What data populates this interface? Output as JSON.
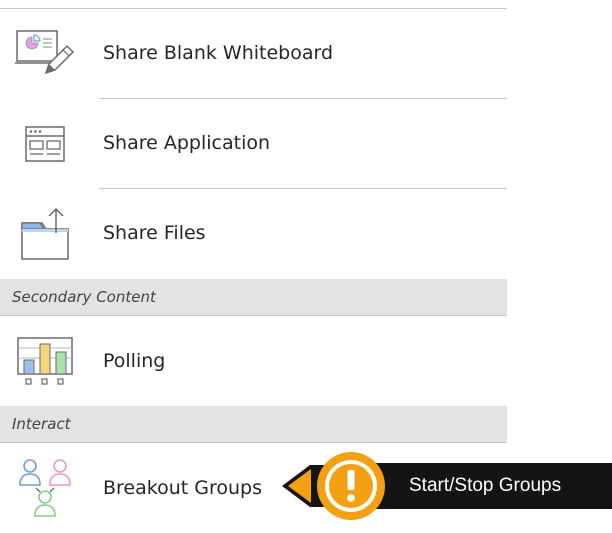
{
  "menu": {
    "items": [
      {
        "label": "Share Blank Whiteboard",
        "icon": "whiteboard-icon"
      },
      {
        "label": "Share Application",
        "icon": "application-window-icon"
      },
      {
        "label": "Share Files",
        "icon": "folder-upload-icon"
      }
    ],
    "sections": [
      {
        "header": "Secondary Content",
        "items": [
          {
            "label": "Polling",
            "icon": "polling-chart-icon"
          }
        ]
      },
      {
        "header": "Interact",
        "items": [
          {
            "label": "Breakout Groups",
            "icon": "breakout-groups-icon"
          }
        ]
      }
    ]
  },
  "callout": {
    "text": "Start/Stop Groups",
    "icon": "alert-exclamation-icon",
    "accent_color": "#f5a012",
    "background_color": "#141414"
  },
  "colors": {
    "section_background": "#e3e3e3",
    "divider": "#c8c8c8",
    "icon_stroke": "#6b6b6b",
    "icon_accent_blue": "#6f9fd8",
    "icon_accent_pink": "#e59ac9",
    "icon_accent_green": "#7fcf8a",
    "icon_accent_yellow": "#f4d77a"
  }
}
